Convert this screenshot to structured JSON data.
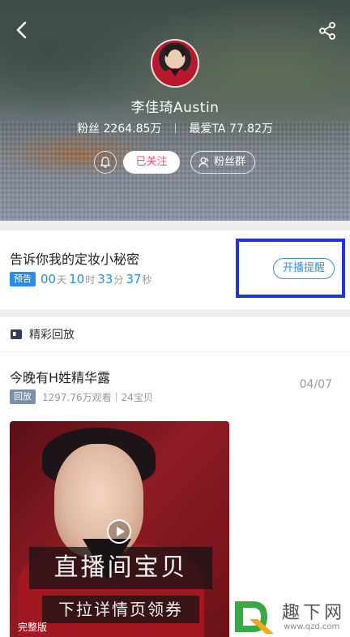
{
  "header": {
    "back_icon": "back-arrow-icon",
    "share_icon": "share-icon",
    "name": "李佳琦Austin",
    "stats": {
      "fans_label": "粉丝",
      "fans_value": "2264.85万",
      "favorite_label": "最爱TA",
      "favorite_value": "77.82万"
    },
    "bell_icon": "bell-icon",
    "follow_label": "已关注",
    "fans_group_label": "粉丝群",
    "follow_color": "#ff4d6a"
  },
  "upcoming": {
    "title": "告诉你我的定妆小秘密",
    "badge": "预告",
    "countdown": {
      "days": "00",
      "days_unit": "天",
      "hours": "10",
      "hours_unit": "时",
      "minutes": "33",
      "minutes_unit": "分",
      "seconds": "37",
      "seconds_unit": "秒"
    },
    "remind_label": "开播提醒",
    "accent": "#2b8be8",
    "highlight_color": "#2233dd"
  },
  "replay": {
    "section_title": "精彩回放",
    "item": {
      "title": "今晚有H姓精华露",
      "badge": "回放",
      "views": "1297.76万观看",
      "items": "24宝贝",
      "date": "04/07",
      "thumb_line1": "直播间宝贝",
      "thumb_line2": "下拉详情页领券",
      "thumb_label": "完整版"
    }
  },
  "watermark": {
    "text": "趣下网",
    "url": "www.qzd.com"
  }
}
